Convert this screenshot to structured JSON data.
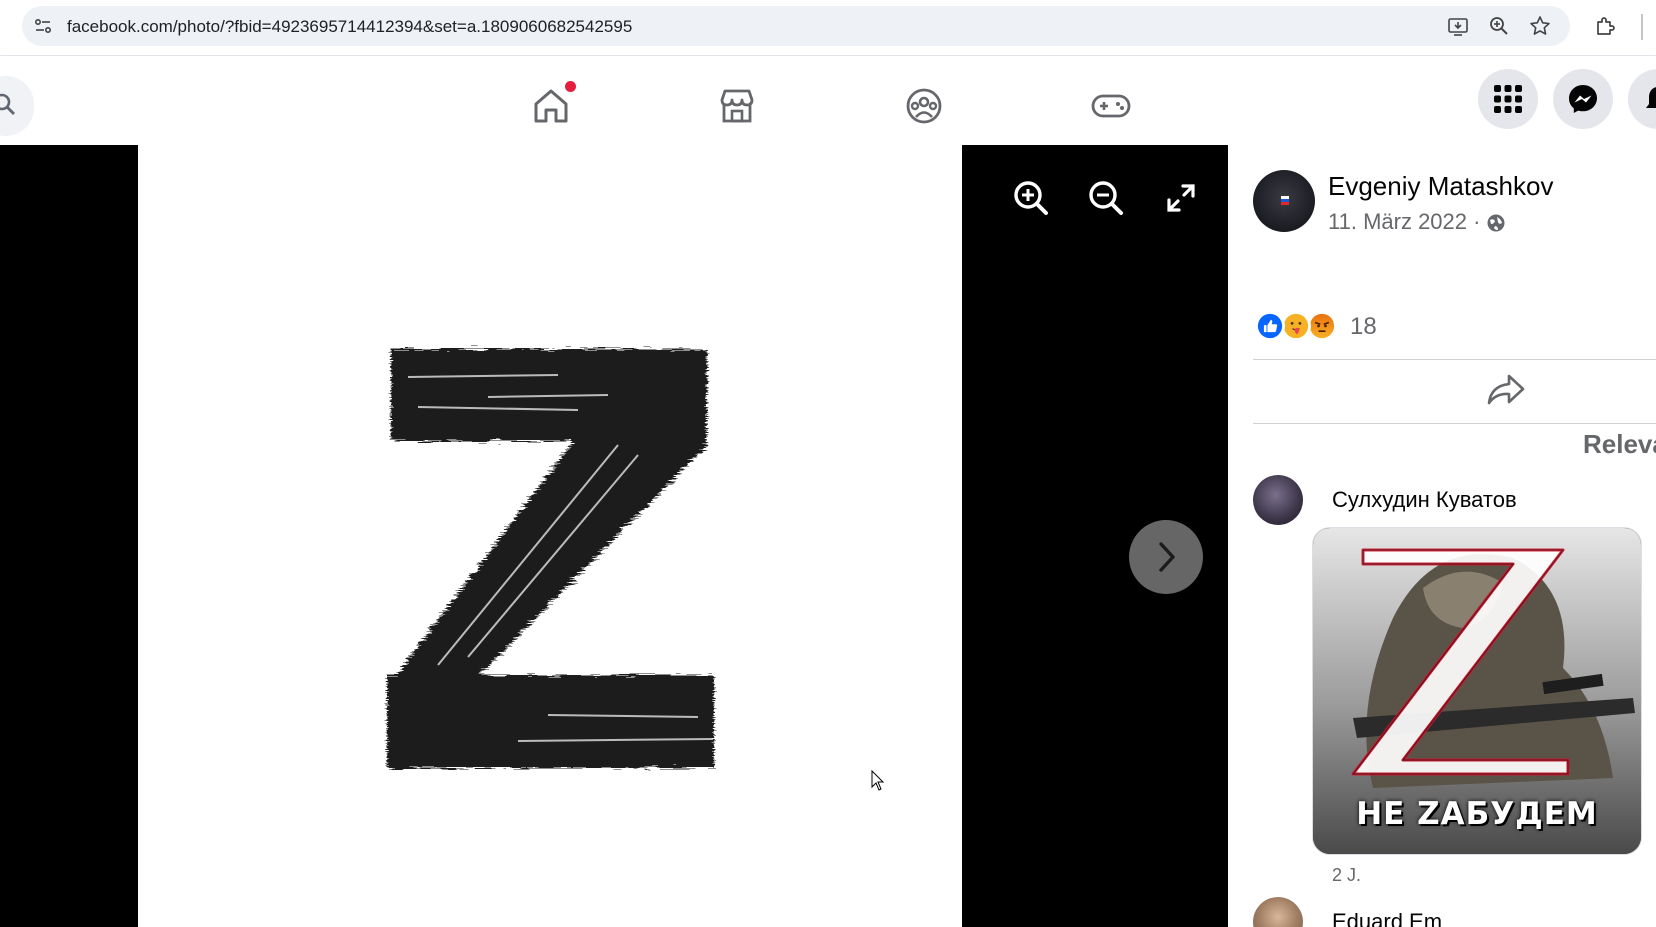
{
  "browser": {
    "url": "facebook.com/photo/?fbid=4923695714412394&set=a.1809060682542595",
    "icons": [
      "site-info-icon",
      "install-app-icon",
      "zoom-icon",
      "bookmark-star-icon",
      "extensions-icon"
    ]
  },
  "nav": {
    "tabs": [
      "home",
      "marketplace",
      "groups",
      "gaming"
    ],
    "home_has_notification": true,
    "right_buttons": [
      "menu-grid",
      "messenger",
      "notifications"
    ]
  },
  "viewer": {
    "tools": [
      "zoom-in",
      "zoom-out",
      "fullscreen"
    ],
    "photo_subject": "Z"
  },
  "post": {
    "author": "Evgeniy Matashkov",
    "date": "11. März 2022 · ",
    "privacy_icon": "globe-icon",
    "reaction_types": [
      "like",
      "care",
      "angry"
    ],
    "reaction_count": "18",
    "sort_label": "Relevant"
  },
  "comments": [
    {
      "author": "Сулхудин Куватов",
      "image_caption": "НЕ ZАБУДЕМ",
      "time": "2 J."
    },
    {
      "author": "Eduard Em"
    }
  ],
  "colors": {
    "accent": "#0866ff",
    "badge": "#e41e3f",
    "muted_text": "#65676b",
    "viewer_bg": "#000000"
  }
}
